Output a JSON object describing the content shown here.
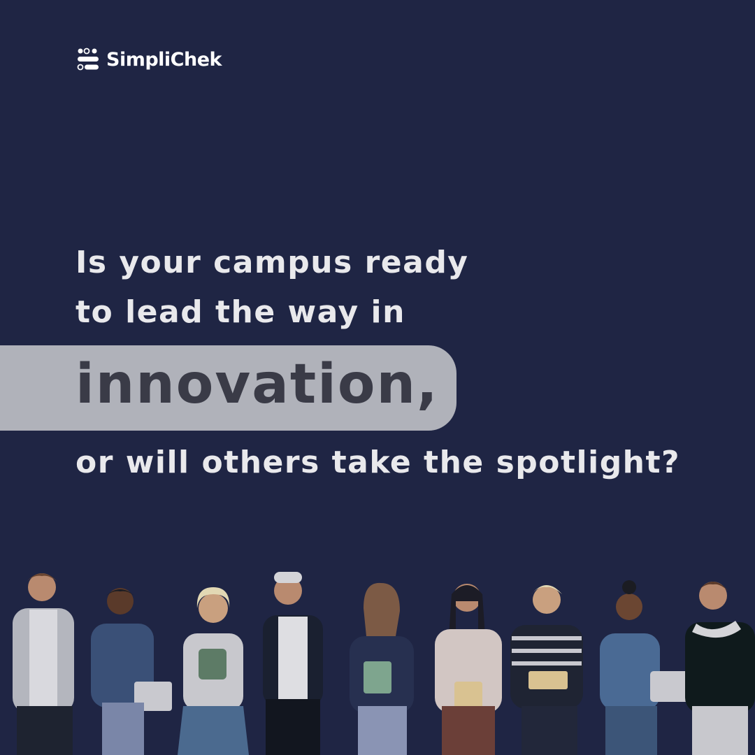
{
  "brand": {
    "name": "SimpliChek"
  },
  "headline": {
    "line1": "Is your campus ready",
    "line2": "to lead the way in",
    "highlight": "innovation,",
    "line3": "or will others take the spotlight?"
  },
  "colors": {
    "background": "#1f2544",
    "text": "#e9e9ec",
    "highlight_bg": "#b0b2ba",
    "highlight_text": "#3a3b47"
  },
  "illustration": {
    "icon": "students-group-illustration"
  }
}
